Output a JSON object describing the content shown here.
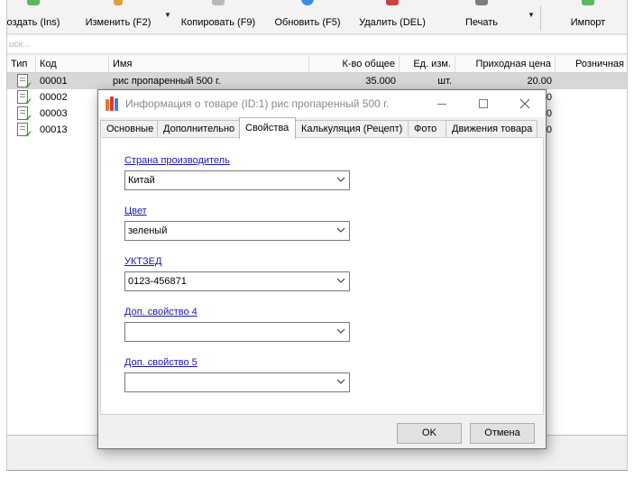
{
  "toolbar": {
    "create_label": "оздать (Ins)",
    "edit_label": "Изменить (F2)",
    "copy_label": "Копировать (F9)",
    "refresh_label": "Обновить (F5)",
    "delete_label": "Удалить (DEL)",
    "print_label": "Печать",
    "import_label": "Импорт"
  },
  "filter": {
    "placeholder": "иск..."
  },
  "grid": {
    "columns": [
      "Тип",
      "Код",
      "Имя",
      "К-во общее",
      "Ед. изм.",
      "Приходная цена",
      "Розничная"
    ],
    "rows": [
      {
        "code": "00001",
        "name": "рис пропаренный 500 г.",
        "qty": "35.000",
        "unit": "шт.",
        "price": "20.00",
        "retail": ""
      },
      {
        "code": "00002",
        "name": "",
        "qty": "",
        "unit": "",
        "price": "0",
        "retail": ""
      },
      {
        "code": "00003",
        "name": "",
        "qty": "",
        "unit": "",
        "price": "0",
        "retail": ""
      },
      {
        "code": "00013",
        "name": "",
        "qty": "",
        "unit": "",
        "price": "0",
        "retail": ""
      }
    ]
  },
  "dialog": {
    "title": "Информация о товаре (ID:1) рис пропаренный 500 г.",
    "tabs": [
      "Основные",
      "Дополнительно",
      "Свойства",
      "Калькуляция (Рецепт)",
      "Фото",
      "Движения товара"
    ],
    "active_tab": "Свойства",
    "properties": [
      {
        "label": "Страна производитель",
        "value": "Китай"
      },
      {
        "label": "Цвет",
        "value": "зеленый"
      },
      {
        "label": "УКТЗЕД",
        "value": "0123-456871"
      },
      {
        "label": "Доп. свойство 4",
        "value": ""
      },
      {
        "label": "Доп. свойство 5",
        "value": ""
      }
    ],
    "ok_label": "OK",
    "cancel_label": "Отмена"
  },
  "colors": {
    "accent_link": "#1a1aa8",
    "selected_row": "#d7d7d7",
    "check_green": "#3aa62a"
  }
}
